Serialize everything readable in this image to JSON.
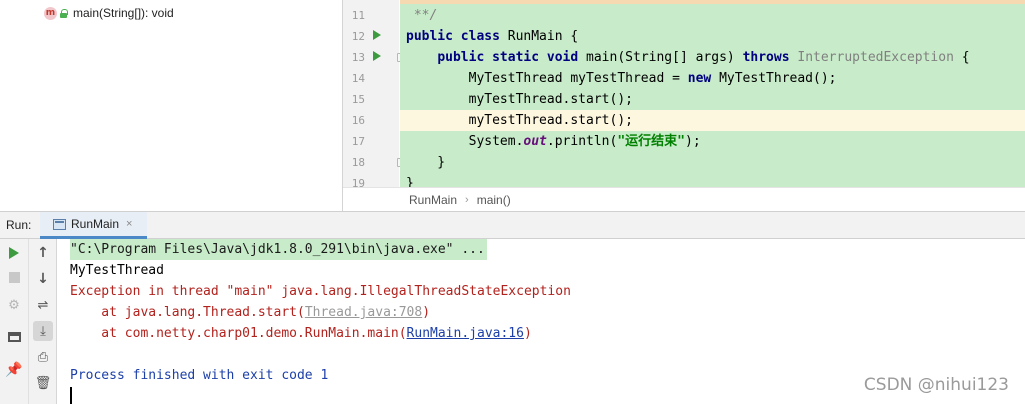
{
  "structure": {
    "item_icon": "m",
    "item_label": "main(String[]): void"
  },
  "editor": {
    "lines": [
      {
        "no": "11",
        "text": " **/"
      },
      {
        "no": "12",
        "kw": "public class",
        "rest": " RunMain {"
      },
      {
        "no": "13"
      },
      {
        "no": "14",
        "text": "        MyTestThread myTestThread = ",
        "kw": "new",
        "rest": " MyTestThread();"
      },
      {
        "no": "15",
        "text": "        myTestThread.start();"
      },
      {
        "no": "16",
        "text": "        myTestThread.start();"
      },
      {
        "no": "17"
      },
      {
        "no": "18",
        "text": "    }"
      },
      {
        "no": "19",
        "text": "}"
      }
    ],
    "line13": {
      "indent": "    ",
      "kw": "public static void",
      "mid": " main(String[] args) ",
      "throws": "throws",
      "exc": " InterruptedException",
      "end": " {"
    },
    "line17": {
      "pre": "        System.",
      "field": "out",
      "mid": ".println(",
      "str": "\"运行结束\"",
      "end": ");"
    }
  },
  "breadcrumb": {
    "items": [
      "RunMain",
      "main()"
    ],
    "separator": "›"
  },
  "run_panel": {
    "label": "Run:",
    "tab_label": "RunMain",
    "tab_close": "×"
  },
  "console": {
    "cmd": "\"C:\\Program Files\\Java\\jdk1.8.0_291\\bin\\java.exe\" ...",
    "out1": "MyTestThread",
    "exception": "Exception in thread \"main\" java.lang.IllegalThreadStateException",
    "trace1_pre": "    at java.lang.Thread.start(",
    "trace1_link": "Thread.java:708",
    "trace1_post": ")",
    "trace2_pre": "    at com.netty.charp01.demo.RunMain.main(",
    "trace2_link": "RunMain.java:16",
    "trace2_post": ")",
    "exit": "Process finished with exit code 1"
  },
  "watermark": "CSDN @nihui123",
  "icons": {
    "rerun": "play-icon",
    "stop": "stop-icon",
    "settings": "gear-icon",
    "layout": "layout-icon",
    "pin": "pin-icon",
    "up": "arrow-up-icon",
    "down": "arrow-down-icon",
    "wrap": "soft-wrap-icon",
    "scroll_end": "scroll-to-end-icon",
    "print": "print-icon",
    "clear": "trash-icon"
  },
  "colors": {
    "code_bg": "#c8ebc9",
    "highlight_line": "#fdf7e0",
    "keyword": "#000080",
    "error": "#b2221d",
    "link": "#1c3fa8",
    "run_green": "#3d9b3f"
  }
}
